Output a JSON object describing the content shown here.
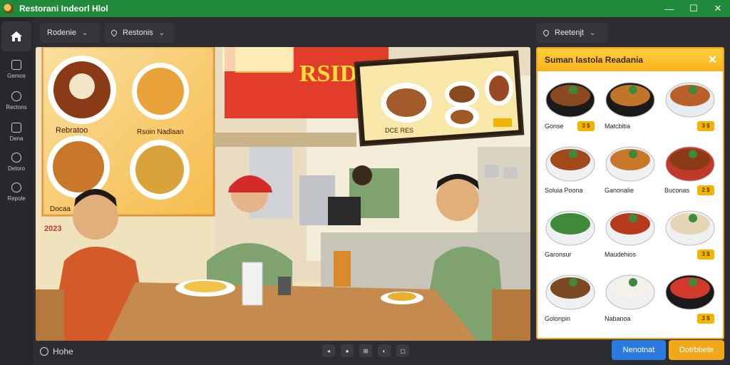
{
  "window": {
    "title": "Restorani Indeorl Hlol"
  },
  "rail": {
    "items": [
      {
        "label": "Gemos"
      },
      {
        "label": "Rectons"
      },
      {
        "label": "Dena"
      },
      {
        "label": "Detoro"
      },
      {
        "label": "Repole"
      }
    ]
  },
  "toolbar": {
    "dropdown1": "Rodenie",
    "dropdown2": "Restonis",
    "dropdown3": "Reetenjt"
  },
  "scene": {
    "menu_board_title": "RSIDENOU",
    "poster_label_1": "Rebratoo",
    "poster_label_2": "Rsoin Nadlaan",
    "poster_label_3": "Docaa",
    "poster_year": "2023",
    "menu_board_caption": "DCE RES"
  },
  "panel": {
    "title": "Suman Iastola Readania",
    "items": [
      {
        "label": "Gonse",
        "badge": "3 $"
      },
      {
        "label": "Matcbitia",
        "badge": ""
      },
      {
        "label": "",
        "badge": "3 $"
      },
      {
        "label": "Soluia Poona",
        "badge": ""
      },
      {
        "label": "Ganonalie",
        "badge": ""
      },
      {
        "label": "Buconas",
        "badge": "2 $"
      },
      {
        "label": "Garonsur",
        "badge": ""
      },
      {
        "label": "Maudehios",
        "badge": ""
      },
      {
        "label": "",
        "badge": "3 $"
      },
      {
        "label": "Golonpin",
        "badge": ""
      },
      {
        "label": "Nabanoa",
        "badge": ""
      },
      {
        "label": "",
        "badge": "3 $"
      }
    ]
  },
  "bottom": {
    "status": "Hohe",
    "tools": [
      "◂",
      "●",
      "⊞",
      "◐",
      "▢"
    ],
    "btn_primary": "Nenotnat",
    "btn_secondary": "Dotrbbete"
  },
  "colors": {
    "titlebar": "#1f8a3a",
    "accent_blue": "#2a7ae0",
    "accent_orange": "#f3a81b"
  }
}
